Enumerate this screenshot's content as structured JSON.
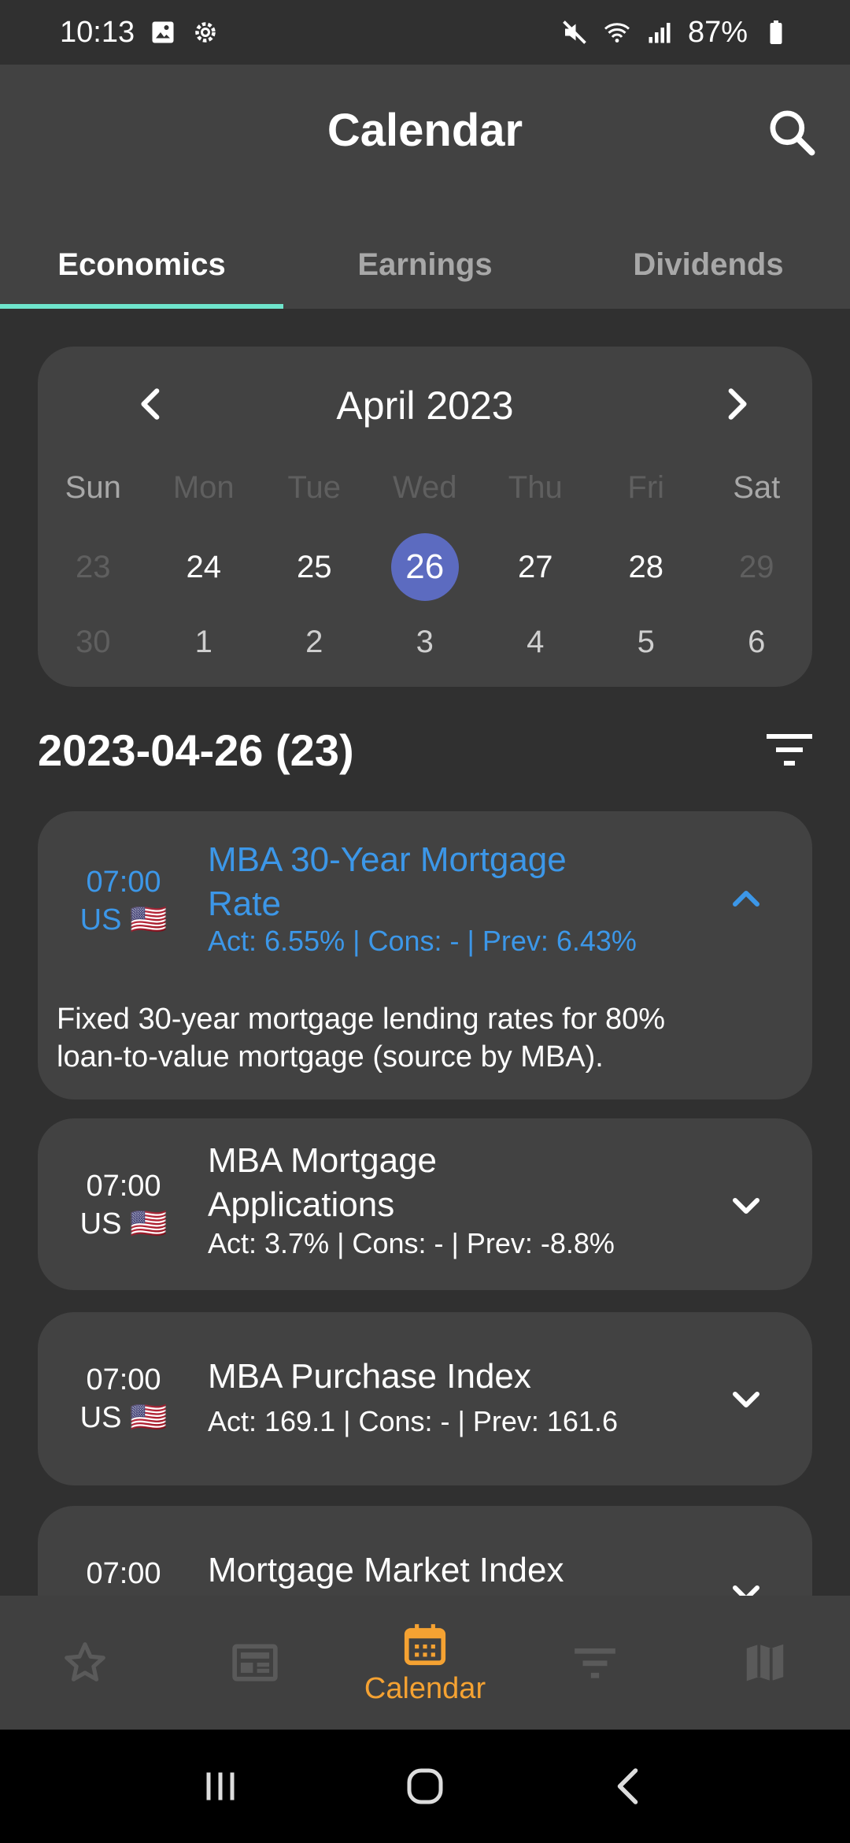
{
  "status": {
    "time": "10:13",
    "battery": "87%"
  },
  "header": {
    "title": "Calendar"
  },
  "tabs": [
    {
      "label": "Economics",
      "active": true
    },
    {
      "label": "Earnings",
      "active": false
    },
    {
      "label": "Dividends",
      "active": false
    }
  ],
  "calendar": {
    "month_label": "April 2023",
    "weekdays": [
      "Sun",
      "Mon",
      "Tue",
      "Wed",
      "Thu",
      "Fri",
      "Sat"
    ],
    "week1": [
      "23",
      "24",
      "25",
      "26",
      "27",
      "28",
      "29"
    ],
    "week2": [
      "30",
      "1",
      "2",
      "3",
      "4",
      "5",
      "6"
    ],
    "selected_day": "26"
  },
  "list": {
    "title": "2023-04-26 (23)"
  },
  "events": [
    {
      "time": "07:00",
      "country": "US 🇺🇸",
      "title_line1": "MBA 30-Year Mortgage",
      "title_line2": "Rate",
      "values": "Act: 6.55% | Cons: - | Prev: 6.43%",
      "description_line1": "Fixed 30-year mortgage lending rates for 80%",
      "description_line2": "loan-to-value mortgage (source by MBA).",
      "expanded": true
    },
    {
      "time": "07:00",
      "country": "US 🇺🇸",
      "title_line1": "MBA Mortgage",
      "title_line2": "Applications",
      "values": "Act: 3.7% | Cons: - | Prev: -8.8%",
      "expanded": false
    },
    {
      "time": "07:00",
      "country": "US 🇺🇸",
      "title_line1": "MBA Purchase Index",
      "values": "Act: 169.1 | Cons: - | Prev: 161.6",
      "expanded": false
    },
    {
      "time": "07:00",
      "title_line1": "Mortgage Market Index",
      "expanded": false
    }
  ],
  "bottom_nav": {
    "active_label": "Calendar"
  },
  "colors": {
    "accent_tab": "#6fe5cc",
    "selected_day": "#5c6bc0",
    "expanded_text": "#3c97e8",
    "active_nav": "#f5a232"
  }
}
